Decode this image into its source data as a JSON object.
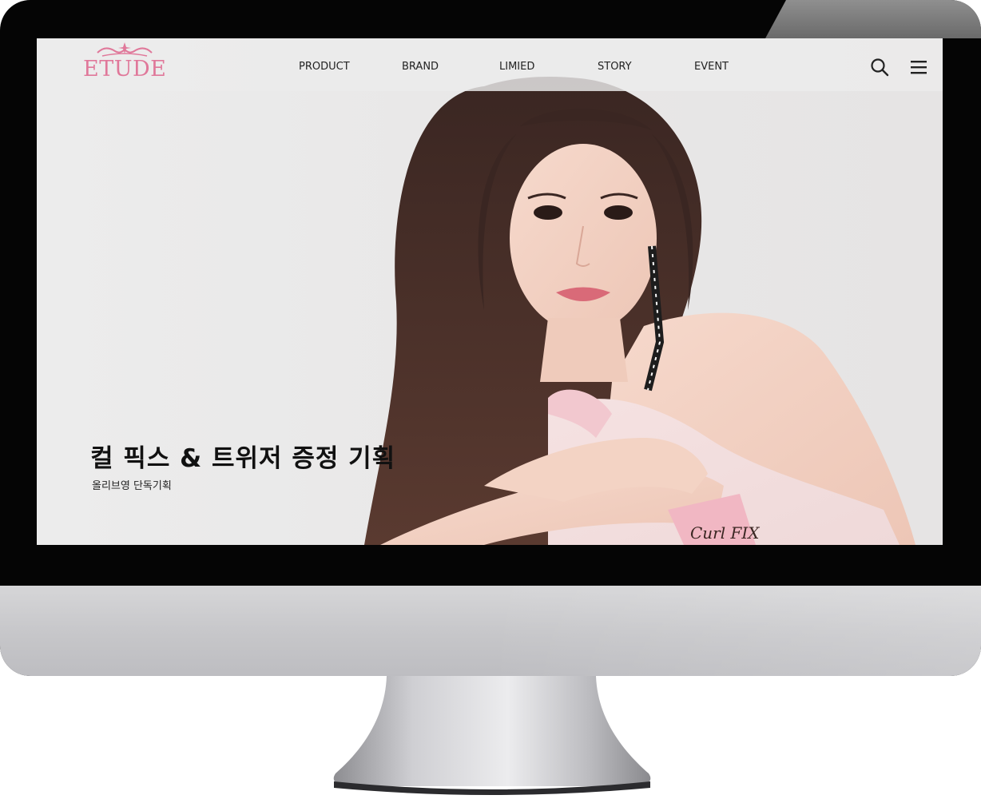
{
  "logo": {
    "text": "ETUDE"
  },
  "nav": {
    "items": [
      {
        "label": "PRODUCT"
      },
      {
        "label": "BRAND"
      },
      {
        "label": "LIMIED"
      },
      {
        "label": "STORY"
      },
      {
        "label": "EVENT"
      }
    ]
  },
  "header_icons": {
    "search": "search-icon",
    "menu": "hamburger-menu-icon"
  },
  "hero": {
    "title": "컬 픽스 & 트위저 증정 기획",
    "subtitle": "올리브영 단독기획",
    "product_label": "Curl FIX"
  },
  "colors": {
    "brand_pink": "#e0789a",
    "header_bg": "#ececec",
    "text_dark": "#111111"
  }
}
